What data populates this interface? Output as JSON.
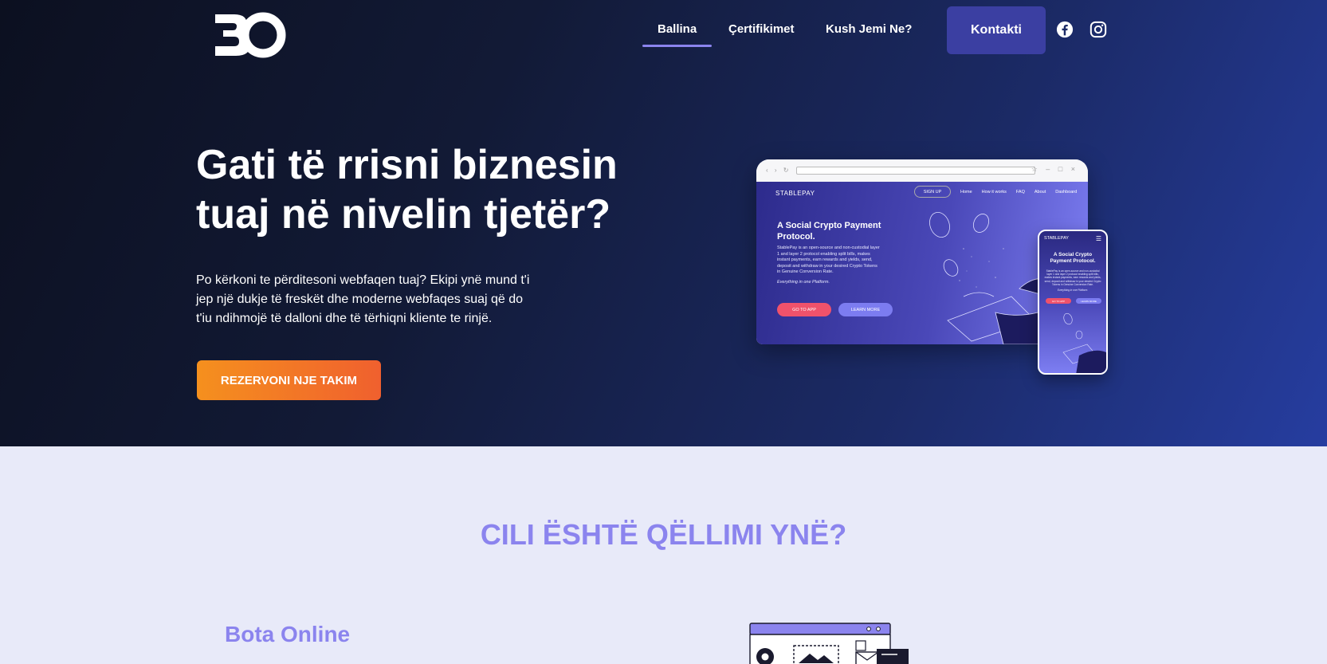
{
  "brand": {
    "logo_text": "BO"
  },
  "nav": {
    "items": [
      {
        "label": "Ballina",
        "active": true
      },
      {
        "label": "Çertifikimet",
        "active": false
      },
      {
        "label": "Kush Jemi Ne?",
        "active": false
      }
    ],
    "contact_label": "Kontakti",
    "social_icons": [
      "facebook-icon",
      "instagram-icon"
    ]
  },
  "hero": {
    "title_line1": "Gati të rrisni biznesin",
    "title_line2": "tuaj në nivelin tjetër?",
    "text_line1": "Po kërkoni te përditesoni webfaqen tuaj? Ekipi ynë mund t'i",
    "text_line2": "jep një dukje të freskët dhe moderne webfaqes suaj që do",
    "text_line3": "t'iu ndihmojë të dalloni dhe të tërhiqni kliente te rinjë.",
    "cta_label": "REZERVONI NJE TAKIM"
  },
  "mockup": {
    "brand": "STABLEPAY",
    "signup": "SIGN UP",
    "links": [
      "Home",
      "How it works",
      "FAQ",
      "About",
      "Dashboard"
    ],
    "title_line1": "A Social Crypto Payment",
    "title_line2": "Protocol.",
    "desc": "StablePay is an open-source and non-custodial layer 1 and layer 2 protocol enabling split bills, makes instant payments, earn rewards and yields, send, deposit and withdraw in your desired Crypto Tokens in Genuine Conversion Rate.",
    "everything": "Everything in one Platform.",
    "btn_app": "GO TO APP",
    "btn_learn": "LEARN MORE",
    "phone_brand": "STABLEPAY",
    "phone_title": "A Social Crypto Payment Protocol."
  },
  "section2": {
    "title": "CILI ËSHTË QËLLIMI YNË?",
    "subtitle": "Bota Online"
  },
  "colors": {
    "accent": "#8b84ee",
    "contact_bg": "#3b3fa2",
    "cta_start": "#f5901e",
    "cta_end": "#f0602e",
    "section_bg": "#e8eaf9"
  }
}
